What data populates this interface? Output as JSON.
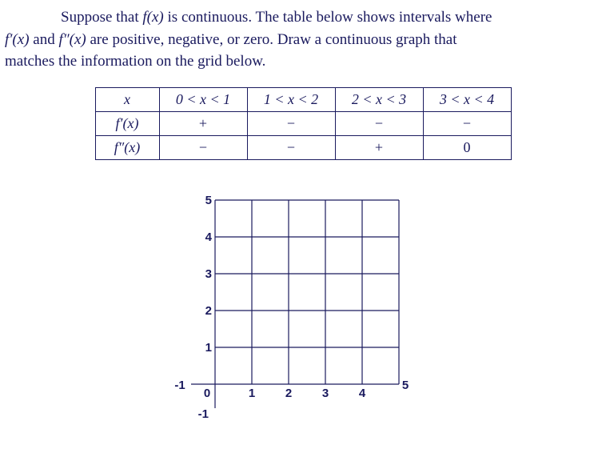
{
  "problem": {
    "line1_a": "Suppose that ",
    "fx": "f(x)",
    "line1_b": " is continuous. The table below shows intervals where",
    "fpx": "f′(x)",
    "and": " and ",
    "fppx": "f″(x)",
    "line2": " are positive, negative, or zero.  Draw a continuous graph that",
    "line3": "matches the information on the grid below."
  },
  "table": {
    "header_x": "x",
    "intervals": [
      "0 < x < 1",
      "1 < x < 2",
      "2 < x < 3",
      "3 < x < 4"
    ],
    "row1_label": "f′(x)",
    "row1": [
      "+",
      "−",
      "−",
      "−"
    ],
    "row2_label": "f″(x)",
    "row2": [
      "−",
      "−",
      "+",
      "0"
    ]
  },
  "grid": {
    "x_ticks": [
      "-1",
      "0",
      "1",
      "2",
      "3",
      "4",
      "5"
    ],
    "y_ticks": [
      "-1",
      "1",
      "2",
      "3",
      "4",
      "5"
    ]
  },
  "chart_data": {
    "type": "table",
    "title": "Sign of first and second derivatives on subintervals",
    "categories": [
      "0<x<1",
      "1<x<2",
      "2<x<3",
      "3<x<4"
    ],
    "series": [
      {
        "name": "f'(x)",
        "values": [
          "+",
          "-",
          "-",
          "-"
        ]
      },
      {
        "name": "f''(x)",
        "values": [
          "-",
          "-",
          "+",
          "0"
        ]
      }
    ],
    "grid_axes": {
      "xlim": [
        -1,
        5
      ],
      "ylim": [
        -1,
        5
      ]
    }
  }
}
